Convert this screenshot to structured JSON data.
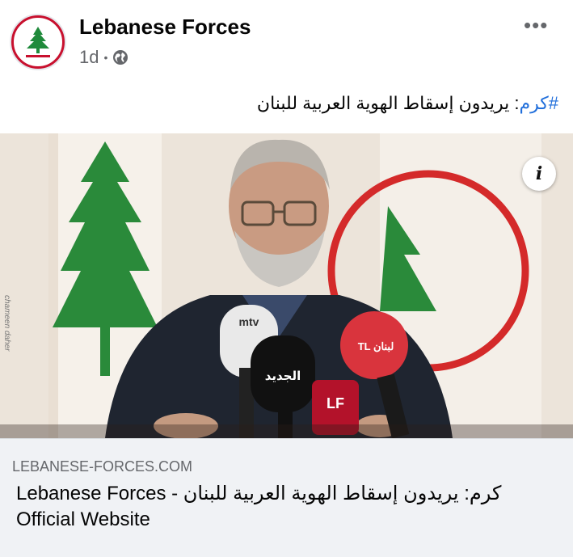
{
  "header": {
    "page_name": "Lebanese Forces",
    "timestamp": "1d",
    "separator": "•",
    "privacy_icon": "globe-icon",
    "more_label": "•••"
  },
  "post": {
    "hashtag": "#كرم",
    "text": ": يريدون إسقاط الهوية العربية للبنان"
  },
  "photo": {
    "credit": "chameen daher",
    "mic_labels": [
      "mtv",
      "الجديد",
      "LF",
      "TL لبنان"
    ],
    "info_icon": "info-icon"
  },
  "link_preview": {
    "domain": "LEBANESE-FORCES.COM",
    "title": "كرم: يريدون إسقاط الهوية العربية للبنان - Lebanese Forces Official Website"
  },
  "colors": {
    "brand_red": "#c8102e",
    "cedar_green": "#1f8a3b",
    "hashtag_blue": "#216fdb",
    "meta_gray": "#65676b",
    "card_bg": "#f0f2f5"
  }
}
